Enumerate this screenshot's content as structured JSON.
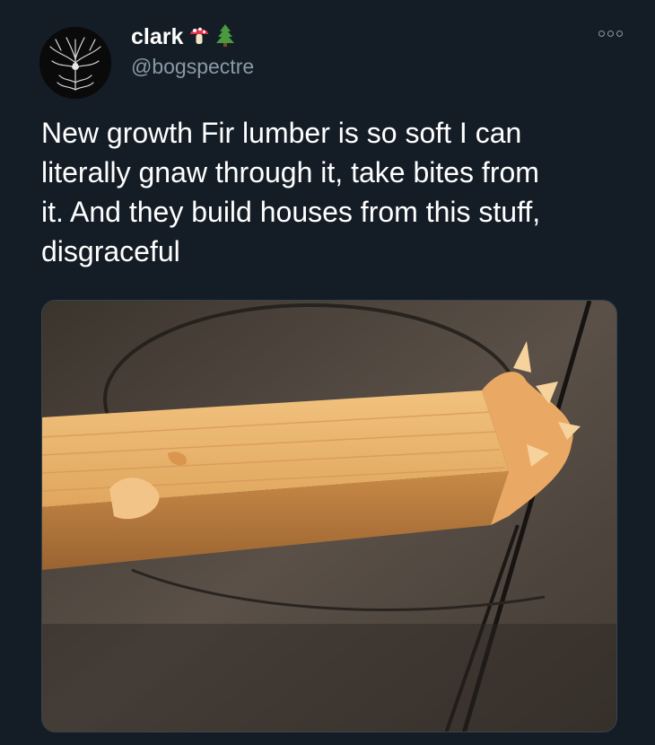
{
  "tweet": {
    "display_name": "clark",
    "badges": [
      "mushroom-emoji",
      "evergreen-tree-emoji"
    ],
    "handle": "@bogspectre",
    "text": "New growth Fir lumber is so soft I can\nliterally gnaw through it, take bites from\nit. And they build houses from this stuff,\ndisgraceful",
    "more_icon": "more-options-icon"
  },
  "media": {
    "subject": "chewed-fir-board-photo"
  },
  "colors": {
    "background": "#141d26",
    "text": "#ffffff",
    "secondary_text": "#8899a6",
    "border": "#38444d"
  }
}
